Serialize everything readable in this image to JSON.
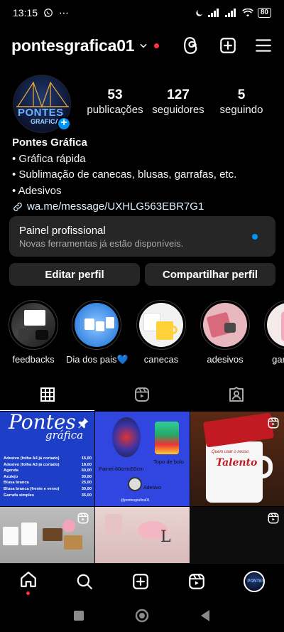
{
  "status_bar": {
    "time": "13:15",
    "dots": "⋯",
    "battery": "80"
  },
  "header": {
    "username": "pontesgrafica01"
  },
  "profile": {
    "avatar_text": "PONTES",
    "avatar_sub": "GRAFICA",
    "stats": [
      {
        "value": "53",
        "label": "publicações"
      },
      {
        "value": "127",
        "label": "seguidores"
      },
      {
        "value": "5",
        "label": "seguindo"
      }
    ]
  },
  "bio": {
    "name": "Pontes Gráfica",
    "lines": [
      "• Gráfica rápida",
      "• Sublimação de canecas, blusas, garrafas, etc.",
      "• Adesivos"
    ],
    "link": "wa.me/message/UXHLG563EBR7G1"
  },
  "panel": {
    "title": "Painel profissional",
    "subtitle": "Novas ferramentas já estão disponíveis."
  },
  "buttons": {
    "edit": "Editar perfil",
    "share": "Compartilhar perfil"
  },
  "highlights": [
    {
      "label": "feedbacks"
    },
    {
      "label": "Dia dos pais💙"
    },
    {
      "label": "canecas"
    },
    {
      "label": "adesivos"
    },
    {
      "label": "garrafas"
    }
  ],
  "posts": {
    "p1": {
      "title": "Pontes",
      "subtitle": "gráfica",
      "rows": [
        [
          "Adesivo (folha A4 já cortado)",
          "15,00"
        ],
        [
          "Adesivo (folha A3 já cortado)",
          "18,00"
        ],
        [
          "Agenda",
          "60,00"
        ],
        [
          "Azulejo",
          "30,00"
        ],
        [
          "Blusa branca",
          "25,00"
        ],
        [
          "Blusa branca (frente e verso)",
          "30,00"
        ],
        [
          "Garrafa simples",
          "35,00"
        ]
      ]
    },
    "p2": {
      "label1": "Painel 60cmx60cm",
      "label2": "Topo de bolo",
      "label3": "Adesivo",
      "handle": "@pontesgrafica01"
    },
    "p3": {
      "mug_text1": "Quem usar o nosso",
      "mug_text2": "Talento"
    },
    "p5": {
      "letter": "L"
    }
  },
  "colors": {
    "accent": "#0095f6",
    "notification": "#ff3040",
    "panel": "#262626"
  }
}
